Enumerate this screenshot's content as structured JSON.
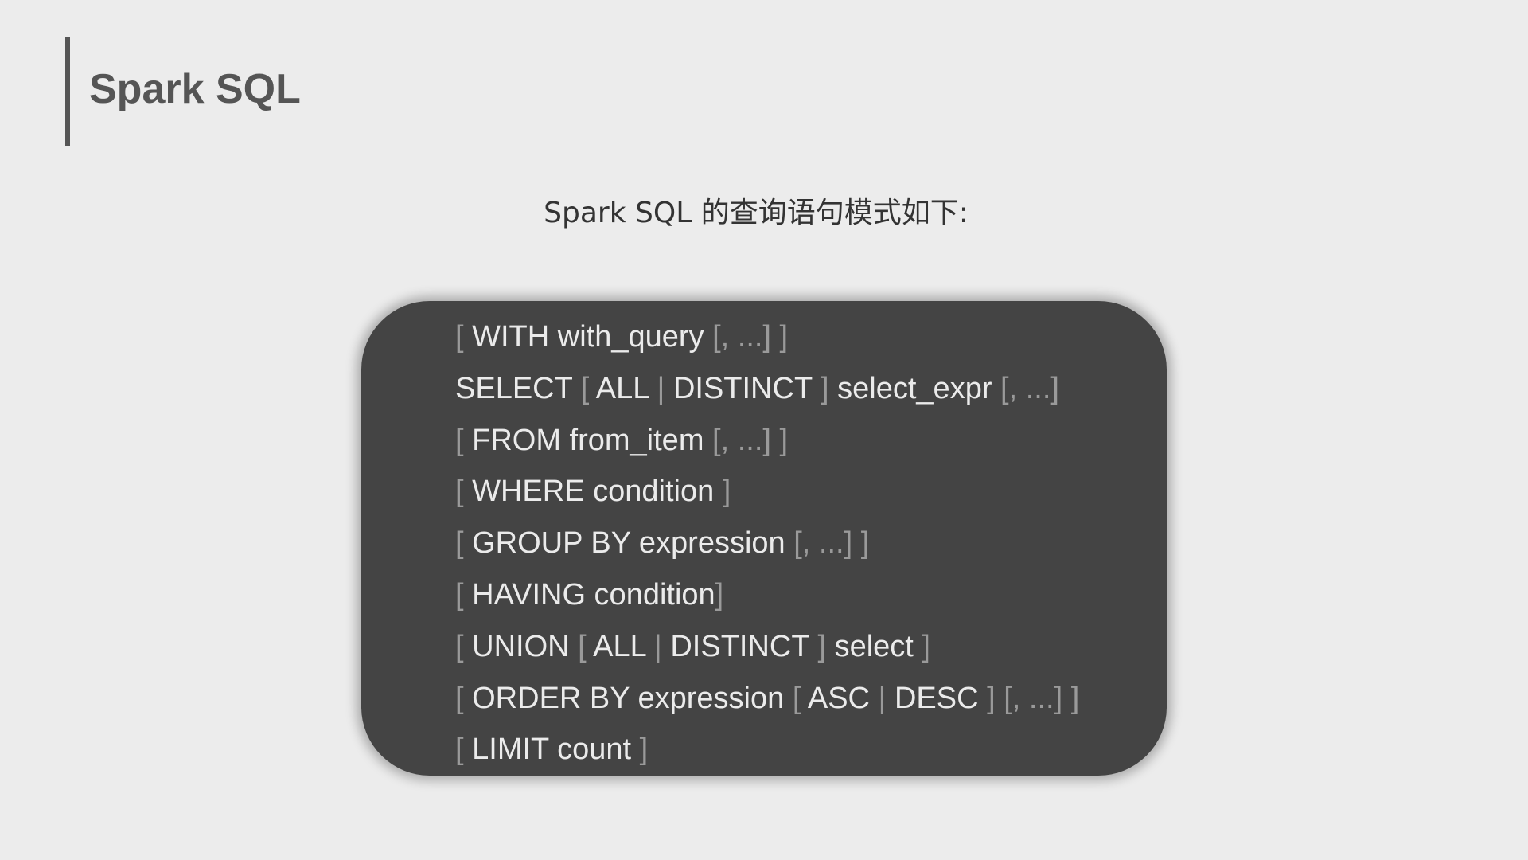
{
  "header": {
    "title": "Spark SQL"
  },
  "subtitle": "Spark SQL 的查询语句模式如下:",
  "code_lines": [
    [
      {
        "t": "[ ",
        "k": "sym"
      },
      {
        "t": "WITH with_query",
        "k": "kw"
      },
      {
        "t": " [, ...] ]",
        "k": "sym"
      }
    ],
    [
      {
        "t": "SELECT ",
        "k": "kw"
      },
      {
        "t": "[ ",
        "k": "sym"
      },
      {
        "t": "ALL",
        "k": "kw"
      },
      {
        "t": " | ",
        "k": "sym"
      },
      {
        "t": "DISTINCT",
        "k": "kw"
      },
      {
        "t": " ] ",
        "k": "sym"
      },
      {
        "t": "select_expr",
        "k": "kw"
      },
      {
        "t": " [, ...]",
        "k": "sym"
      }
    ],
    [
      {
        "t": "[ ",
        "k": "sym"
      },
      {
        "t": "FROM from_item",
        "k": "kw"
      },
      {
        "t": " [, ...] ]",
        "k": "sym"
      }
    ],
    [
      {
        "t": "[ ",
        "k": "sym"
      },
      {
        "t": "WHERE condition",
        "k": "kw"
      },
      {
        "t": " ]",
        "k": "sym"
      }
    ],
    [
      {
        "t": "[ ",
        "k": "sym"
      },
      {
        "t": "GROUP BY expression",
        "k": "kw"
      },
      {
        "t": " [, ...] ]",
        "k": "sym"
      }
    ],
    [
      {
        "t": "[ ",
        "k": "sym"
      },
      {
        "t": "HAVING condition",
        "k": "kw"
      },
      {
        "t": "]",
        "k": "sym"
      }
    ],
    [
      {
        "t": "[ ",
        "k": "sym"
      },
      {
        "t": "UNION ",
        "k": "kw"
      },
      {
        "t": "[ ",
        "k": "sym"
      },
      {
        "t": "ALL",
        "k": "kw"
      },
      {
        "t": " | ",
        "k": "sym"
      },
      {
        "t": "DISTINCT",
        "k": "kw"
      },
      {
        "t": " ] ",
        "k": "sym"
      },
      {
        "t": "select",
        "k": "kw"
      },
      {
        "t": " ]",
        "k": "sym"
      }
    ],
    [
      {
        "t": "[ ",
        "k": "sym"
      },
      {
        "t": "ORDER BY expression ",
        "k": "kw"
      },
      {
        "t": "[ ",
        "k": "sym"
      },
      {
        "t": "ASC",
        "k": "kw"
      },
      {
        "t": " | ",
        "k": "sym"
      },
      {
        "t": "DESC",
        "k": "kw"
      },
      {
        "t": " ] [, ...] ]",
        "k": "sym"
      }
    ],
    [
      {
        "t": "[ ",
        "k": "sym"
      },
      {
        "t": "LIMIT count",
        "k": "kw"
      },
      {
        "t": " ]",
        "k": "sym"
      }
    ]
  ],
  "colors": {
    "background": "#ececec",
    "title": "#555555",
    "code_box": "#444444",
    "code_keyword": "#ebebeb",
    "code_symbol": "#9a9a9a"
  }
}
